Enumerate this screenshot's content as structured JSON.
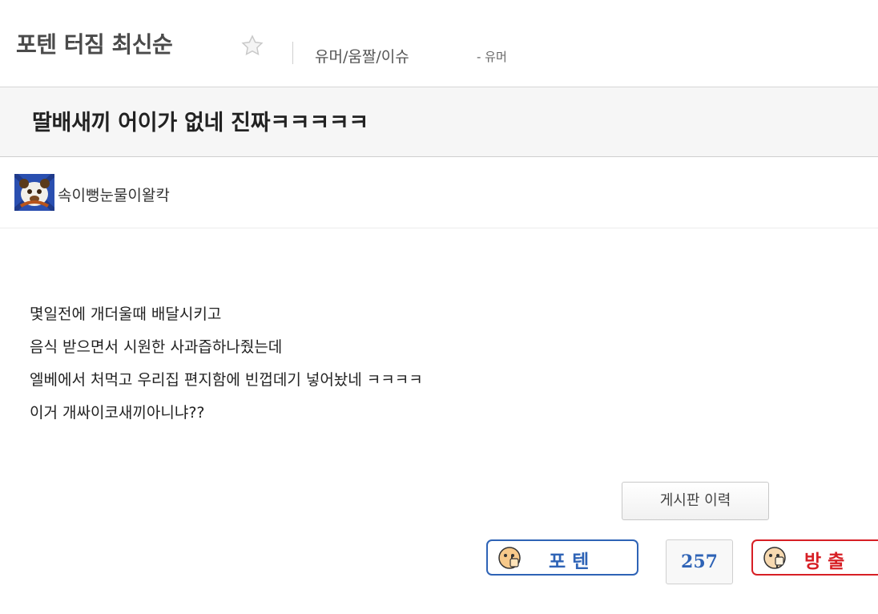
{
  "board": {
    "title": "포텐 터짐 최신순",
    "category_path": "유머/움짤/이슈",
    "category_sub": "- 유머"
  },
  "post": {
    "title": "딸배새끼 어이가 없네 진짜ㅋㅋㅋㅋㅋ",
    "author": "속이뻥눈물이왈칵",
    "body": [
      "몇일전에 개더울때 배달시키고",
      "음식 받으면서 시원한 사과즙하나줬는데",
      "엘베에서 처먹고 우리집 편지함에 빈껍데기 넣어놨네 ㅋㅋㅋㅋ",
      "이거 개싸이코새끼아니냐??"
    ]
  },
  "actions": {
    "history_label": "게시판 이력",
    "upvote_label": "포텐",
    "vote_count": "257",
    "downvote_label": "방출"
  },
  "colors": {
    "upvote": "#2e63b6",
    "downvote": "#d71f25",
    "header_bg": "#f6f6f6"
  },
  "icons": {
    "favorite": "star-outline-icon",
    "upvote": "thumbs-up-face-icon",
    "downvote": "thumbs-down-face-icon"
  }
}
